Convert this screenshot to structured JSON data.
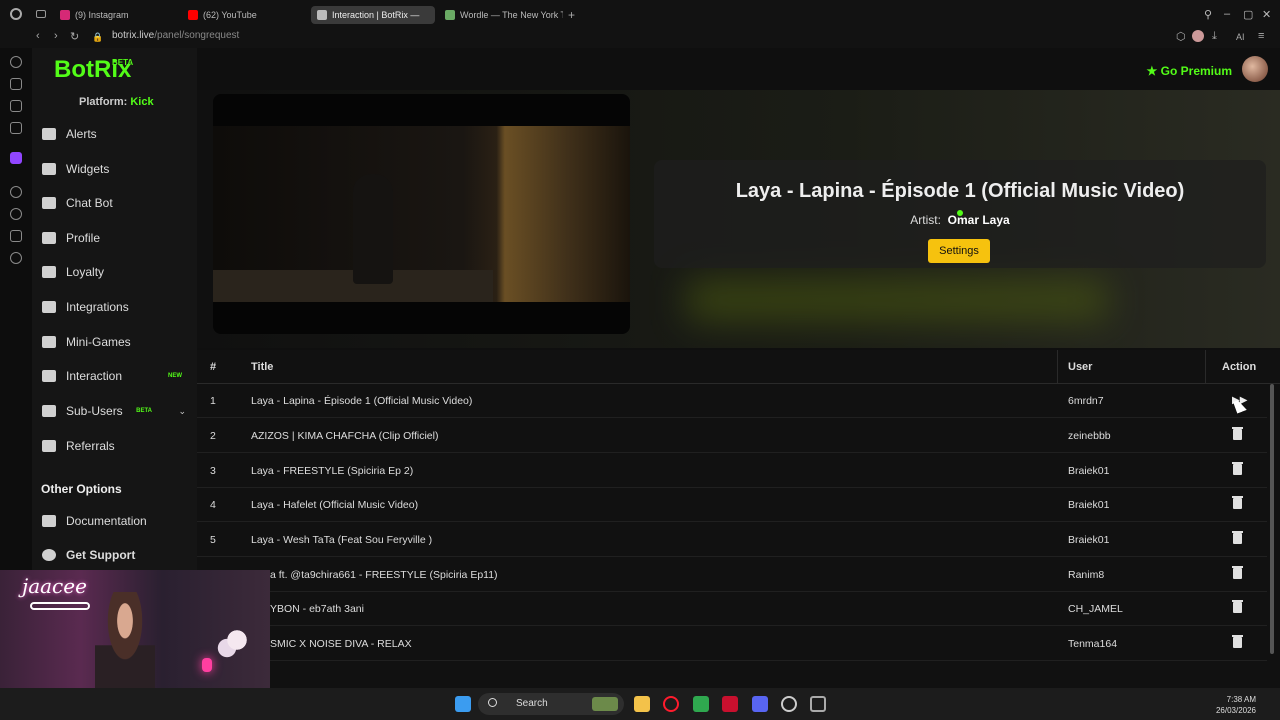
{
  "browser": {
    "tabs": [
      {
        "label": "(9) Instagram",
        "color": "#d62976"
      },
      {
        "label": "(62) YouTube",
        "color": "#ff0000"
      },
      {
        "label": "Interaction | BotRix —",
        "color": "#888888"
      },
      {
        "label": "Wordle — The New York T",
        "color": "#6aaa64"
      }
    ],
    "url_domain": "botrix.live",
    "url_path": "/panel/songrequest",
    "ai_label": "AI"
  },
  "sidebar": {
    "logo": "BotRix",
    "logo_badge": "BETA",
    "platform_label": "Platform:",
    "platform_value": "Kick",
    "items": [
      {
        "label": "Alerts",
        "icon": "alert-icon"
      },
      {
        "label": "Widgets",
        "icon": "widgets-icon"
      },
      {
        "label": "Chat Bot",
        "icon": "robot-icon"
      },
      {
        "label": "Profile",
        "icon": "profile-icon"
      },
      {
        "label": "Loyalty",
        "icon": "trophy-icon"
      },
      {
        "label": "Integrations",
        "icon": "integrations-icon"
      },
      {
        "label": "Mini-Games",
        "icon": "gamepad-icon"
      },
      {
        "label": "Interaction",
        "icon": "music-icon",
        "badge": "NEW"
      },
      {
        "label": "Sub-Users",
        "icon": "users-icon",
        "badge": "BETA"
      },
      {
        "label": "Referrals",
        "icon": "referrals-icon"
      }
    ],
    "other_heading": "Other Options",
    "other_items": [
      {
        "label": "Documentation",
        "icon": "docs-icon"
      },
      {
        "label": "Get Support",
        "icon": "support-icon"
      }
    ]
  },
  "header": {
    "premium_label": "Go Premium"
  },
  "now_playing": {
    "title": "Laya - Lapina - Épisode 1 (Official Music Video)",
    "artist_label": "Artist:",
    "artist": "Omar Laya",
    "settings_label": "Settings"
  },
  "queue": {
    "headers": {
      "num": "#",
      "title": "Title",
      "user": "User",
      "action": "Action"
    },
    "rows": [
      {
        "num": "1",
        "title": "Laya - Lapina - Épisode 1 (Official Music Video)",
        "user": "6mrdn7"
      },
      {
        "num": "2",
        "title": "AZIZOS | KIMA CHAFCHA (Clip Officiel)",
        "user": "zeinebbb"
      },
      {
        "num": "3",
        "title": "Laya - FREESTYLE (Spiciria Ep 2)",
        "user": "Braiek01"
      },
      {
        "num": "4",
        "title": "Laya - Hafelet (Official Music Video)",
        "user": "Braiek01"
      },
      {
        "num": "5",
        "title": "Laya - Wesh TaTa (Feat Sou Feryville )",
        "user": "Braiek01"
      },
      {
        "num": "",
        "title": "a ft. @ta9chira661 - FREESTYLE (Spiciria Ep11)",
        "user": "Ranim8"
      },
      {
        "num": "",
        "title": "YBON - eb7ath 3ani",
        "user": "CH_JAMEL"
      },
      {
        "num": "",
        "title": "SMIC X NOISE DIVA - RELAX",
        "user": "Tenma164"
      }
    ]
  },
  "webcam": {
    "name": "jaacee"
  },
  "taskbar": {
    "search": "Search",
    "time": "7:38 AM",
    "date": "26/03/2026"
  }
}
